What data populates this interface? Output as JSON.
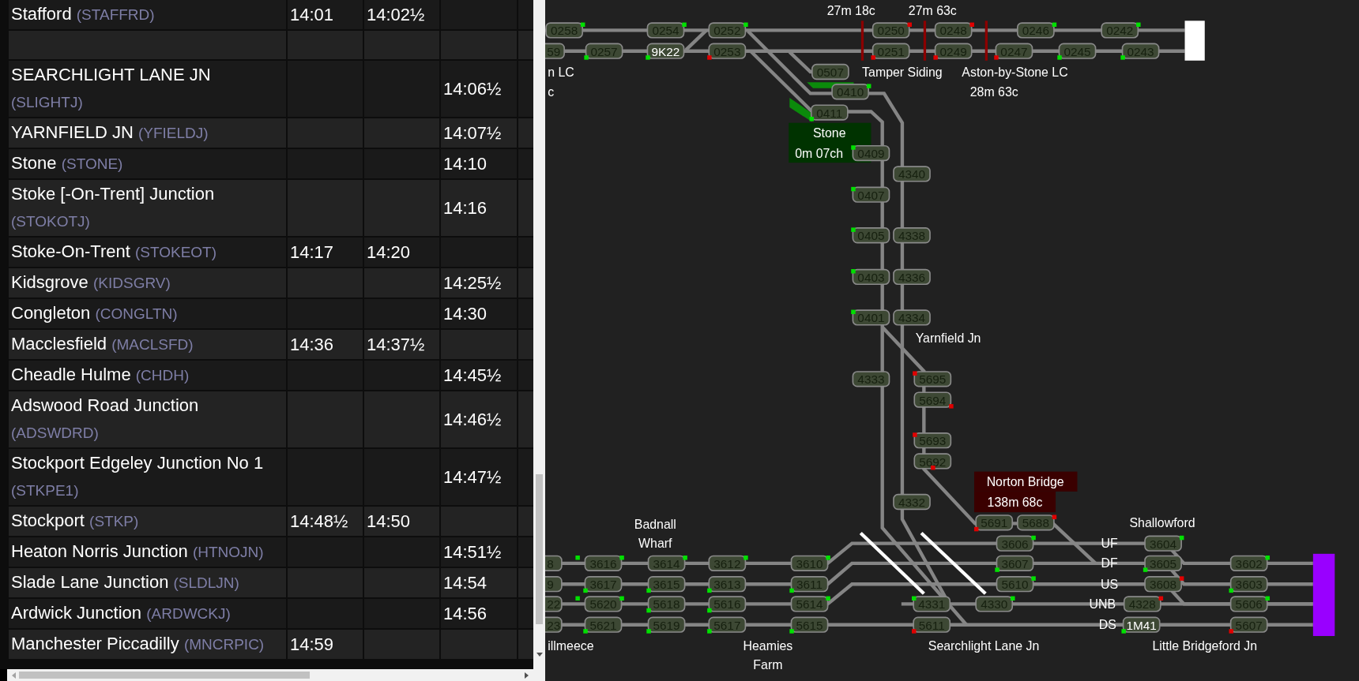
{
  "timetable": {
    "rows": [
      {
        "kind": "stop",
        "name": "Stafford",
        "code": "(STAFFRD)",
        "arrive": "14:01",
        "depart": "14:02½"
      },
      {
        "kind": "spacer"
      },
      {
        "kind": "stop",
        "name": "SEARCHLIGHT LANE JN",
        "code": "(SLIGHTJ)",
        "pass": "14:06½"
      },
      {
        "kind": "stop",
        "name": "YARNFIELD JN",
        "code": "(YFIELDJ)",
        "pass": "14:07½"
      },
      {
        "kind": "stop",
        "name": "Stone",
        "code": "(STONE)",
        "pass": "14:10"
      },
      {
        "kind": "stop",
        "name": "Stoke [-On-Trent] Junction",
        "code": "(STOKOTJ)",
        "pass": "14:16"
      },
      {
        "kind": "stop",
        "name": "Stoke-On-Trent",
        "code": "(STOKEOT)",
        "arrive": "14:17",
        "depart": "14:20"
      },
      {
        "kind": "stop",
        "name": "Kidsgrove",
        "code": "(KIDSGRV)",
        "pass": "14:25½"
      },
      {
        "kind": "stop",
        "name": "Congleton",
        "code": "(CONGLTN)",
        "pass": "14:30"
      },
      {
        "kind": "stop",
        "name": "Macclesfield",
        "code": "(MACLSFD)",
        "arrive": "14:36",
        "depart": "14:37½"
      },
      {
        "kind": "stop",
        "name": "Cheadle Hulme",
        "code": "(CHDH)",
        "pass": "14:45½"
      },
      {
        "kind": "stop",
        "name": "Adswood Road Junction",
        "code": "(ADSWDRD)",
        "pass": "14:46½"
      },
      {
        "kind": "stop",
        "name": "Stockport Edgeley Junction No 1",
        "code": "(STKPE1)",
        "pass": "14:47½"
      },
      {
        "kind": "stop",
        "name": "Stockport",
        "code": "(STKP)",
        "arrive": "14:48½",
        "depart": "14:50"
      },
      {
        "kind": "stop",
        "name": "Heaton Norris Junction",
        "code": "(HTNOJN)",
        "pass": "14:51½"
      },
      {
        "kind": "stop",
        "name": "Slade Lane Junction",
        "code": "(SLDLJN)",
        "pass": "14:54"
      },
      {
        "kind": "stop",
        "name": "Ardwick Junction",
        "code": "(ARDWCKJ)",
        "pass": "14:56"
      },
      {
        "kind": "stop",
        "name": "Manchester Piccadilly",
        "code": "(MNCRPIC)",
        "arrive": "14:59"
      }
    ]
  },
  "diagram": {
    "berths": [
      {
        "text": "0258",
        "occupied": false,
        "proceed": true
      },
      {
        "text": "59",
        "occupied": false
      },
      {
        "text": "0257",
        "occupied": false,
        "proceed": true
      },
      {
        "text": "0254",
        "occupied": false,
        "proceed": true
      },
      {
        "text": "9K22",
        "occupied": true,
        "proceed": true
      },
      {
        "text": "0252",
        "occupied": false,
        "proceed": true
      },
      {
        "text": "0253",
        "occupied": false,
        "proceed": false
      },
      {
        "text": "0250",
        "occupied": false,
        "proceed": false
      },
      {
        "text": "0251",
        "occupied": false,
        "proceed": false
      },
      {
        "text": "0248",
        "occupied": false,
        "proceed": false
      },
      {
        "text": "0249",
        "occupied": false,
        "proceed": false
      },
      {
        "text": "0246",
        "occupied": false,
        "proceed": true
      },
      {
        "text": "0247",
        "occupied": false,
        "proceed": false
      },
      {
        "text": "0245",
        "occupied": false,
        "proceed": true
      },
      {
        "text": "0242",
        "occupied": false,
        "proceed": true
      },
      {
        "text": "0243",
        "occupied": false,
        "proceed": true
      },
      {
        "text": "0507",
        "occupied": false
      },
      {
        "text": "0410",
        "occupied": false,
        "proceed": true
      },
      {
        "text": "0411",
        "occupied": false,
        "proceed": true
      },
      {
        "text": "0409",
        "occupied": false,
        "proceed": true
      },
      {
        "text": "4340",
        "occupied": false
      },
      {
        "text": "0407",
        "occupied": false,
        "proceed": true
      },
      {
        "text": "0405",
        "occupied": false,
        "proceed": true
      },
      {
        "text": "4338",
        "occupied": false
      },
      {
        "text": "0403",
        "occupied": false,
        "proceed": true
      },
      {
        "text": "4336",
        "occupied": false
      },
      {
        "text": "0401",
        "occupied": false,
        "proceed": true
      },
      {
        "text": "4334",
        "occupied": false
      },
      {
        "text": "4333",
        "occupied": false
      },
      {
        "text": "5695",
        "occupied": false,
        "proceed": false
      },
      {
        "text": "5694",
        "occupied": false,
        "proceed": false
      },
      {
        "text": "5693",
        "occupied": false,
        "proceed": false
      },
      {
        "text": "5692",
        "occupied": false,
        "proceed": false
      },
      {
        "text": "4332",
        "occupied": false
      },
      {
        "text": "5691",
        "occupied": false,
        "proceed": false
      },
      {
        "text": "5688",
        "occupied": false,
        "proceed": false
      },
      {
        "text": "8",
        "occupied": false,
        "proceed": true
      },
      {
        "text": "3616",
        "occupied": false,
        "proceed": true
      },
      {
        "text": "3614",
        "occupied": false,
        "proceed": true
      },
      {
        "text": "3612",
        "occupied": false,
        "proceed": true
      },
      {
        "text": "3610",
        "occupied": false,
        "proceed": true
      },
      {
        "text": "9",
        "occupied": false
      },
      {
        "text": "3617",
        "occupied": false,
        "proceed": true
      },
      {
        "text": "3615",
        "occupied": false,
        "proceed": true
      },
      {
        "text": "3613",
        "occupied": false,
        "proceed": true
      },
      {
        "text": "3611",
        "occupied": false,
        "proceed": true
      },
      {
        "text": "22",
        "occupied": false,
        "proceed": true
      },
      {
        "text": "5620",
        "occupied": false,
        "proceed": true
      },
      {
        "text": "5618",
        "occupied": false,
        "proceed": true
      },
      {
        "text": "5616",
        "occupied": false,
        "proceed": true
      },
      {
        "text": "5614",
        "occupied": false,
        "proceed": true
      },
      {
        "text": "23",
        "occupied": false
      },
      {
        "text": "5621",
        "occupied": false,
        "proceed": true
      },
      {
        "text": "5619",
        "occupied": false,
        "proceed": true
      },
      {
        "text": "5617",
        "occupied": false,
        "proceed": true
      },
      {
        "text": "5615",
        "occupied": false,
        "proceed": true
      },
      {
        "text": "4331",
        "occupied": false,
        "proceed": true
      },
      {
        "text": "5611",
        "occupied": false,
        "proceed": false
      },
      {
        "text": "4330",
        "occupied": false,
        "proceed": true
      },
      {
        "text": "3606",
        "occupied": false,
        "proceed": true
      },
      {
        "text": "3607",
        "occupied": false,
        "proceed": true
      },
      {
        "text": "5610",
        "occupied": false,
        "proceed": true
      },
      {
        "text": "3604",
        "occupied": false,
        "proceed": true
      },
      {
        "text": "3605",
        "occupied": false,
        "proceed": true
      },
      {
        "text": "3608",
        "occupied": false,
        "proceed": false
      },
      {
        "text": "4328",
        "occupied": false,
        "proceed": false
      },
      {
        "text": "1M41",
        "occupied": true,
        "proceed": true
      },
      {
        "text": "3602",
        "occupied": false,
        "proceed": true
      },
      {
        "text": "3603",
        "occupied": false,
        "proceed": true
      },
      {
        "text": "5606",
        "occupied": false,
        "proceed": true
      },
      {
        "text": "5607",
        "occupied": false,
        "proceed": false
      }
    ],
    "labels": [
      "27m 18c",
      "27m 63c",
      "n LC",
      "c",
      "Tamper Siding",
      "Aston-by-Stone LC",
      "28m 63c",
      "Yarnfield Jn",
      "Badnall",
      "Wharf",
      "Shallowford",
      "UF",
      "DF",
      "US",
      "UNB",
      "DS",
      "illmeece",
      "Heamies",
      "Farm",
      "Searchlight Lane Jn",
      "Little Bridgeford Jn"
    ],
    "stations": [
      {
        "kind": "platform",
        "name": "Stone",
        "mileage": "0m 07ch"
      },
      {
        "kind": "alarm",
        "name": "Norton Bridge",
        "mileage": "138m 68c"
      }
    ]
  }
}
